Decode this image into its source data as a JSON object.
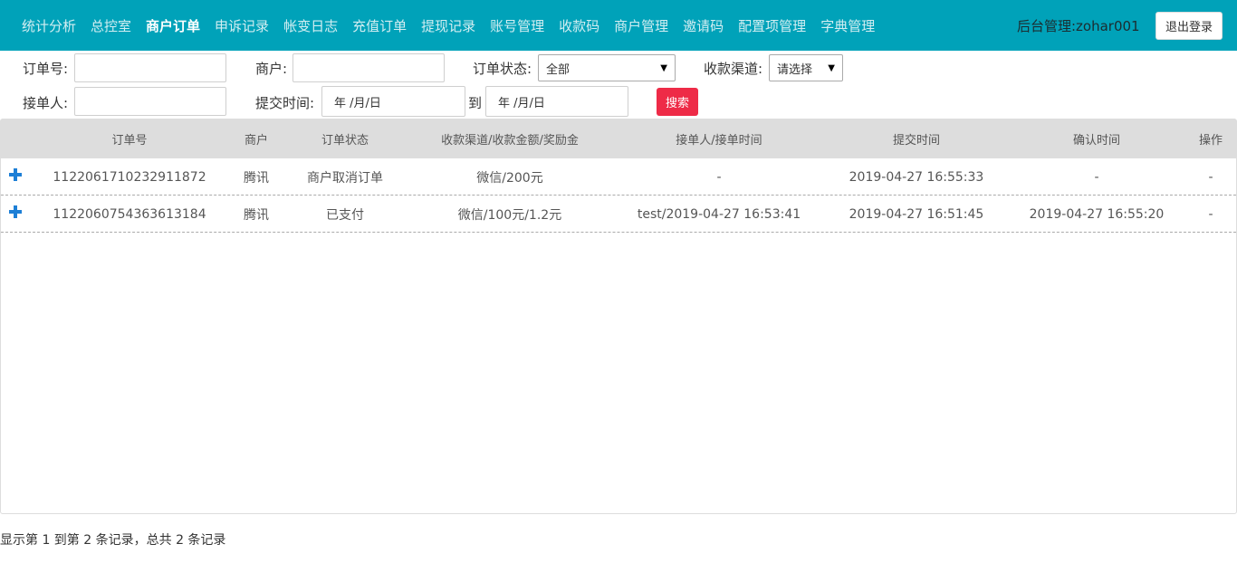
{
  "nav": {
    "items": [
      {
        "label": "统计分析",
        "active": false
      },
      {
        "label": "总控室",
        "active": false
      },
      {
        "label": "商户订单",
        "active": true
      },
      {
        "label": "申诉记录",
        "active": false
      },
      {
        "label": "帐变日志",
        "active": false
      },
      {
        "label": "充值订单",
        "active": false
      },
      {
        "label": "提现记录",
        "active": false
      },
      {
        "label": "账号管理",
        "active": false
      },
      {
        "label": "收款码",
        "active": false
      },
      {
        "label": "商户管理",
        "active": false
      },
      {
        "label": "邀请码",
        "active": false
      },
      {
        "label": "配置项管理",
        "active": false
      },
      {
        "label": "字典管理",
        "active": false
      }
    ],
    "user": "后台管理:zohar001",
    "logout": "退出登录"
  },
  "filters": {
    "order_no": {
      "label": "订单号:",
      "value": ""
    },
    "merchant": {
      "label": "商户:",
      "value": ""
    },
    "status": {
      "label": "订单状态:",
      "selected": "全部"
    },
    "channel": {
      "label": "收款渠道:",
      "selected": "请选择"
    },
    "receiver": {
      "label": "接单人:",
      "value": ""
    },
    "submit_time": {
      "label": "提交时间:",
      "from": "年 /月/日",
      "to_label": "到",
      "to": "年 /月/日"
    },
    "search": "搜索"
  },
  "table": {
    "headers": [
      "订单号",
      "商户",
      "订单状态",
      "收款渠道/收款金额/奖励金",
      "接单人/接单时间",
      "提交时间",
      "确认时间",
      "操作"
    ],
    "rows": [
      [
        "1122061710232911872",
        "腾讯",
        "商户取消订单",
        "微信/200元",
        "-",
        "2019-04-27 16:55:33",
        "-",
        "-"
      ],
      [
        "1122060754363613184",
        "腾讯",
        "已支付",
        "微信/100元/1.2元",
        "test/2019-04-27 16:53:41",
        "2019-04-27 16:51:45",
        "2019-04-27 16:55:20",
        "-"
      ]
    ]
  },
  "pagination": {
    "text": "显示第 1 到第 2 条记录，总共 2 条记录"
  },
  "colors": {
    "navbar": "#00a2b9",
    "search_button": "#ee2b47",
    "expand_icon": "#1d7fd6",
    "table_header": "#dddddd"
  }
}
